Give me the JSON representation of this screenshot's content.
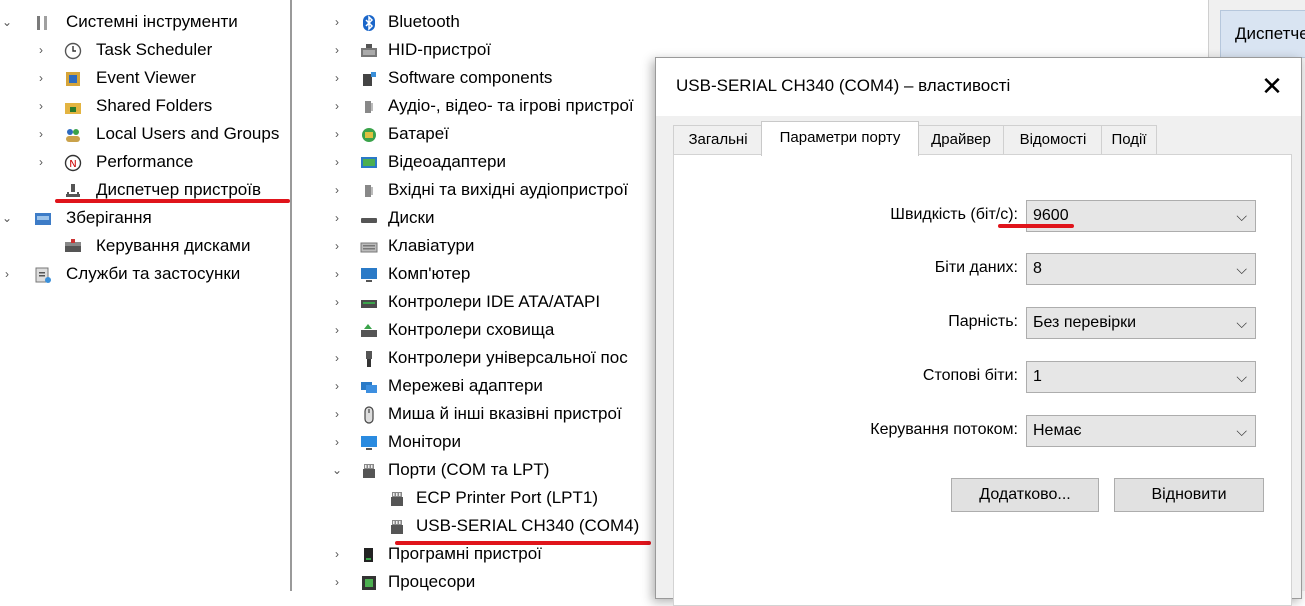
{
  "left_tree": [
    {
      "label": "Системні інструменти",
      "arrow": "⌄",
      "icon": "tools-icon"
    },
    {
      "label": "Task Scheduler",
      "arrow": "›",
      "icon": "clock-icon"
    },
    {
      "label": "Event Viewer",
      "arrow": "›",
      "icon": "event-viewer-icon"
    },
    {
      "label": "Shared Folders",
      "arrow": "›",
      "icon": "shared-folder-icon"
    },
    {
      "label": "Local Users and Groups",
      "arrow": "›",
      "icon": "users-icon"
    },
    {
      "label": "Performance",
      "arrow": "›",
      "icon": "performance-icon"
    },
    {
      "label": "Диспетчер пристроїв",
      "arrow": "",
      "icon": "device-manager-icon"
    },
    {
      "label": "Зберігання",
      "arrow": "⌄",
      "icon": "storage-icon"
    },
    {
      "label": "Керування дисками",
      "arrow": "",
      "icon": "disk-management-icon"
    },
    {
      "label": "Служби та застосунки",
      "arrow": "›",
      "icon": "services-icon"
    }
  ],
  "device_tree": [
    {
      "label": "Bluetooth",
      "arrow": "›",
      "icon": "bluetooth-icon"
    },
    {
      "label": "HID-пристрої",
      "arrow": "›",
      "icon": "hid-icon"
    },
    {
      "label": "Software components",
      "arrow": "›",
      "icon": "software-components-icon"
    },
    {
      "label": "Аудіо-, відео- та ігрові пристрої",
      "arrow": "›",
      "icon": "speaker-icon"
    },
    {
      "label": "Батареї",
      "arrow": "›",
      "icon": "battery-icon"
    },
    {
      "label": "Відеоадаптери",
      "arrow": "›",
      "icon": "display-adapter-icon"
    },
    {
      "label": "Вхідні та вихідні аудіопристрої",
      "arrow": "›",
      "icon": "speaker-icon"
    },
    {
      "label": "Диски",
      "arrow": "›",
      "icon": "disk-drive-icon"
    },
    {
      "label": "Клавіатури",
      "arrow": "›",
      "icon": "keyboard-icon"
    },
    {
      "label": "Комп'ютер",
      "arrow": "›",
      "icon": "computer-icon"
    },
    {
      "label": "Контролери IDE ATA/ATAPI",
      "arrow": "›",
      "icon": "ide-controller-icon"
    },
    {
      "label": "Контролери сховища",
      "arrow": "›",
      "icon": "storage-controller-icon"
    },
    {
      "label": "Контролери універсальної пос",
      "arrow": "›",
      "icon": "usb-icon"
    },
    {
      "label": "Мережеві адаптери",
      "arrow": "›",
      "icon": "network-adapter-icon"
    },
    {
      "label": "Миша й інші вказівні пристрої",
      "arrow": "›",
      "icon": "mouse-icon"
    },
    {
      "label": "Монітори",
      "arrow": "›",
      "icon": "monitor-icon"
    },
    {
      "label": "Порти (COM та LPT)",
      "arrow": "⌄",
      "icon": "port-icon"
    },
    {
      "label": "ECP Printer Port (LPT1)",
      "arrow": "",
      "icon": "port-icon",
      "child": true
    },
    {
      "label": "USB-SERIAL CH340 (COM4)",
      "arrow": "",
      "icon": "port-icon",
      "child": true
    },
    {
      "label": "Програмні пристрої",
      "arrow": "›",
      "icon": "software-device-icon"
    },
    {
      "label": "Процесори",
      "arrow": "›",
      "icon": "processor-icon"
    }
  ],
  "right_strip": {
    "button_label": "Диспетчер пристроїв"
  },
  "dialog": {
    "title": "USB-SERIAL CH340 (COM4) – властивості",
    "close_glyph": "✕",
    "tabs": [
      "Загальні",
      "Параметри порту",
      "Драйвер",
      "Відомості",
      "Події"
    ],
    "active_tab": 1,
    "fields": [
      {
        "label": "Швидкість (біт/с):",
        "value": "9600"
      },
      {
        "label": "Біти даних:",
        "value": "8"
      },
      {
        "label": "Парність:",
        "value": "Без перевірки"
      },
      {
        "label": "Стопові біти:",
        "value": "1"
      },
      {
        "label": "Керування потоком:",
        "value": "Немає"
      }
    ],
    "advanced_button": "Додатково...",
    "restore_button": "Відновити"
  },
  "colors": {
    "highlight": "#e0141b",
    "active_tab_bg": "#ffffff",
    "dialog_bg": "#f0f0f0"
  }
}
